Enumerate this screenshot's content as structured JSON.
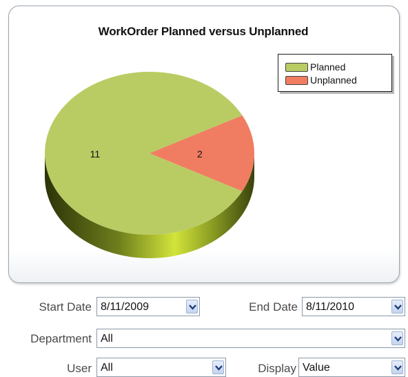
{
  "chart": {
    "title": "WorkOrder Planned versus Unplanned",
    "legend": [
      {
        "label": "Planned",
        "color": "#b9cc63"
      },
      {
        "label": "Unplanned",
        "color": "#f07d62"
      }
    ]
  },
  "chart_data": {
    "type": "pie",
    "title": "WorkOrder Planned versus Unplanned",
    "categories": [
      "Planned",
      "Unplanned"
    ],
    "values": [
      11,
      2
    ],
    "colors": [
      "#b9cc63",
      "#f07d62"
    ],
    "data_labels": [
      "11",
      "2"
    ],
    "legend_position": "top-right",
    "style": "3d"
  },
  "filters": {
    "start_date": {
      "label": "Start Date",
      "value": "8/11/2009"
    },
    "end_date": {
      "label": "End Date",
      "value": "8/11/2010"
    },
    "department": {
      "label": "Department",
      "value": "All"
    },
    "user": {
      "label": "User",
      "value": "All"
    },
    "display": {
      "label": "Display",
      "value": "Value"
    }
  }
}
